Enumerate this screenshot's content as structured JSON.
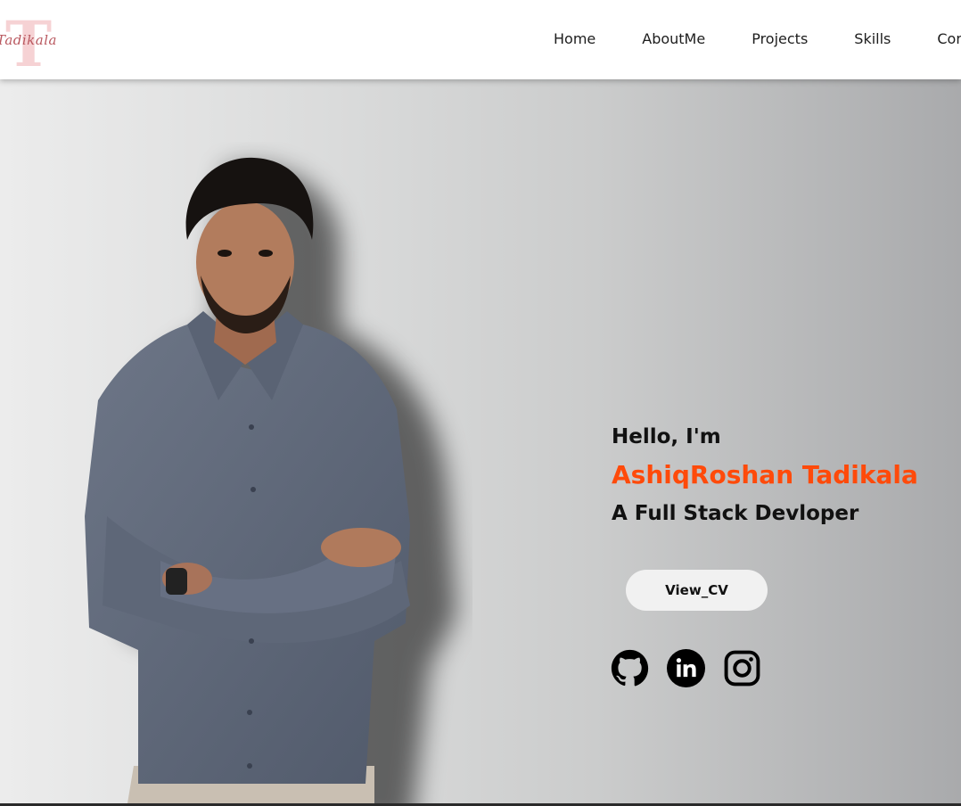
{
  "nav": {
    "logo_letter": "T",
    "logo_signature": "Tadikala",
    "items": [
      {
        "label": "Home"
      },
      {
        "label": "AboutMe"
      },
      {
        "label": "Projects"
      },
      {
        "label": "Skills"
      },
      {
        "label": "Contact"
      }
    ]
  },
  "hero": {
    "greeting": "Hello, I'm",
    "name": "AshiqRoshan Tadikala",
    "role": "A Full Stack Devloper",
    "cv_label": "View_CV",
    "socials": [
      {
        "icon": "github-icon"
      },
      {
        "icon": "linkedin-icon"
      },
      {
        "icon": "instagram-icon"
      }
    ]
  },
  "colors": {
    "accent": "#ff4a0a",
    "button_bg": "#f1f1f1",
    "hero_light": "#ececec",
    "hero_dark": "#a9aaac"
  }
}
